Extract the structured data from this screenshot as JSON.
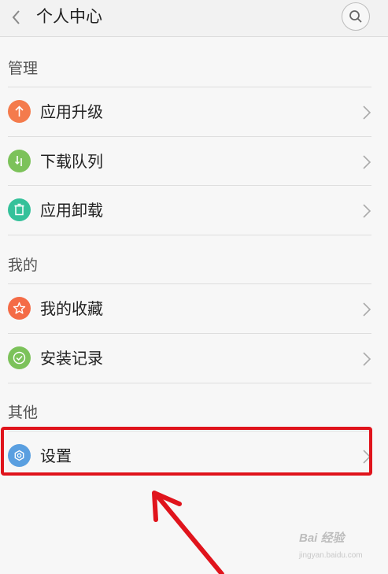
{
  "header": {
    "title": "个人中心",
    "back_icon": "chevron-left-icon",
    "search_icon": "search-icon"
  },
  "sections": [
    {
      "label": "管理",
      "items": [
        {
          "label": "应用升级",
          "icon": "arrow-up-icon",
          "color": "#f47b4c"
        },
        {
          "label": "下载队列",
          "icon": "download-queue-icon",
          "color": "#7cc25a"
        },
        {
          "label": "应用卸载",
          "icon": "trash-icon",
          "color": "#34c19a"
        }
      ]
    },
    {
      "label": "我的",
      "items": [
        {
          "label": "我的收藏",
          "icon": "star-icon",
          "color": "#f46b46"
        },
        {
          "label": "安装记录",
          "icon": "check-circle-icon",
          "color": "#7cc25a"
        }
      ]
    },
    {
      "label": "其他",
      "items": [
        {
          "label": "设置",
          "icon": "gear-icon",
          "color": "#5a9fe0"
        }
      ]
    }
  ],
  "annotation": {
    "highlight_color": "#e0141c",
    "highlighted_item": "设置"
  },
  "watermark": {
    "text": "Bai 经验",
    "sub": "jingyan.baidu.com"
  }
}
